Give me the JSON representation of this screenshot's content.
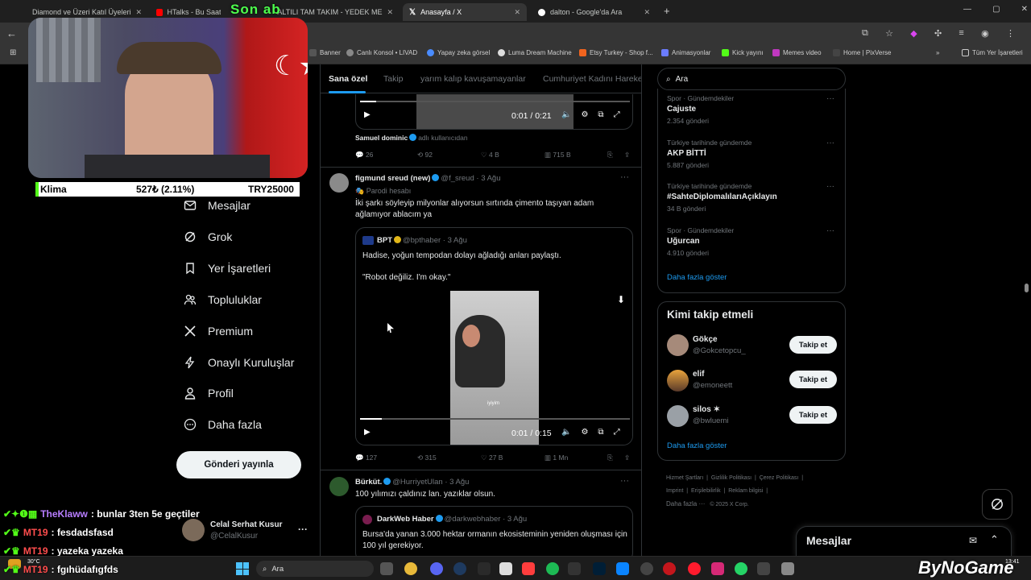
{
  "browser": {
    "tabs": [
      {
        "label": "Diamond ve Üzeri Katıl Üyeleri",
        "active": false
      },
      {
        "label": "HTalks - Bu Saatte Olmaz",
        "active": false
      },
      {
        "label": "ALTILI TAM TAKIM - YEDEK ME",
        "active": false
      },
      {
        "label": "Anasayfa / X",
        "active": true
      },
      {
        "label": "dalton - Google'da Ara",
        "active": false
      }
    ],
    "overlay_text": "Son ab",
    "bookmarks": [
      "Banner",
      "Canlı Konsol • LIVAD",
      "Yapay zeka görsel",
      "Luma Dream Machine",
      "Etsy Turkey - Shop f...",
      "Animasyonlar",
      "Kick yayını",
      "Memes video",
      "Home | PixVerse",
      "»",
      "Tüm Yer İşaretleri"
    ]
  },
  "sidebar": {
    "items": [
      {
        "label": "Mesajlar",
        "icon": "mail-icon"
      },
      {
        "label": "Grok",
        "icon": "grok-icon"
      },
      {
        "label": "Yer İşaretleri",
        "icon": "bookmark-icon"
      },
      {
        "label": "Topluluklar",
        "icon": "people-icon"
      },
      {
        "label": "Premium",
        "icon": "x-icon"
      },
      {
        "label": "Onaylı Kuruluşlar",
        "icon": "bolt-icon"
      },
      {
        "label": "Profil",
        "icon": "person-icon"
      },
      {
        "label": "Daha fazla",
        "icon": "more-circle-icon"
      }
    ],
    "post_button": "Gönderi yayınla",
    "account": {
      "name": "Celal Serhat Kusur",
      "handle": "@CelalKusur",
      "more": "···"
    }
  },
  "feed": {
    "tabs": [
      "Sana özel",
      "Takip",
      "yarım kalıp kavuşamayanlar",
      "Cumhuriyet Kadını Hareke"
    ],
    "post0": {
      "video_time": "0:01 / 0:21",
      "tagged": "Samuel dominic",
      "tagged_suffix": "adlı kullanıcıdan",
      "replies": "26",
      "reposts": "92",
      "likes": "4 B",
      "views": "715 B"
    },
    "post1": {
      "name": "figmund sreud (new)",
      "handle": "@f_sreud · 3 Ağu",
      "label": "Parodi hesabı",
      "text": "İki şarkı söyleyip milyonlar alıyorsun sırtında çimento taşıyan adam ağlamıyor ablacım ya",
      "quote": {
        "name": "BPT",
        "handle": "@bpthaber · 3 Ağu",
        "text1": "Hadise, yoğun tempodan dolayı ağladığı anları paylaştı.",
        "text2": "\"Robot değiliz. I'm okay.\"",
        "caption": "iyiyim",
        "video_time": "0:01 / 0:15"
      },
      "replies": "127",
      "reposts": "315",
      "likes": "27 B",
      "views": "1 Mn"
    },
    "post2": {
      "name": "Bürküt.",
      "handle": "@HurriyetUlan · 3 Ağu",
      "text": "100 yılımızı çaldınız lan. yazıklar olsun.",
      "quote": {
        "name": "DarkWeb Haber",
        "handle": "@darkwebhaber · 3 Ağu",
        "text": "Bursa'da yanan 3.000 hektar ormanın ekosisteminin yeniden oluşması için 100 yıl gerekiyor."
      }
    }
  },
  "right": {
    "search_placeholder": "Ara",
    "trends": [
      {
        "category": "Spor · Gündemdekiler",
        "name": "Cajuste",
        "count": "2.354 gönderi"
      },
      {
        "category": "Türkiye tarihinde gündemde",
        "name": "AKP BİTTİ",
        "count": "5.887 gönderi"
      },
      {
        "category": "Türkiye tarihinde gündemde",
        "name": "#SahteDiplomalılarıAçıklayın",
        "count": "34 B gönderi"
      },
      {
        "category": "Spor · Gündemdekiler",
        "name": "Uğurcan",
        "count": "4.910 gönderi"
      }
    ],
    "trends_more": "Daha fazla göster",
    "who_title": "Kimi takip etmeli",
    "who": [
      {
        "name": "Gökçe",
        "handle": "@Gokcetopcu_",
        "button": "Takip et"
      },
      {
        "name": "elif",
        "handle": "@emoneett",
        "button": "Takip et"
      },
      {
        "name": "silos ✶",
        "handle": "@bwluemi",
        "button": "Takip et"
      }
    ],
    "who_more": "Daha fazla göster",
    "footer": [
      "Hizmet Şartları",
      "Gizlilik Politikası",
      "Çerez Politikası",
      "Imprint",
      "Erişilebilirlik",
      "Reklam bilgisi",
      "Daha fazla ···",
      "© 2025 X Corp."
    ],
    "messages": "Mesajlar"
  },
  "stream": {
    "ticker": {
      "name": "Klima",
      "value": "527₺ (2.11%)",
      "goal": "TRY25000"
    },
    "chat": [
      {
        "user": "TheKlaww",
        "msg": ": bunlar 3ten 5e geçtiler",
        "color": "#b77dff"
      },
      {
        "user": "MT19",
        "msg": ": fesdadsfasd",
        "color": "#ff4d4d"
      },
      {
        "user": "MT19",
        "msg": ": yazeka yazeka",
        "color": "#ff4d4d"
      },
      {
        "user": "MT19",
        "msg": ": fgıhüdafıgfds",
        "color": "#ff4d4d"
      }
    ],
    "watermark": "ByNoGame"
  },
  "taskbar": {
    "search": "Ara",
    "weather": "30°C",
    "time": "13:41"
  }
}
